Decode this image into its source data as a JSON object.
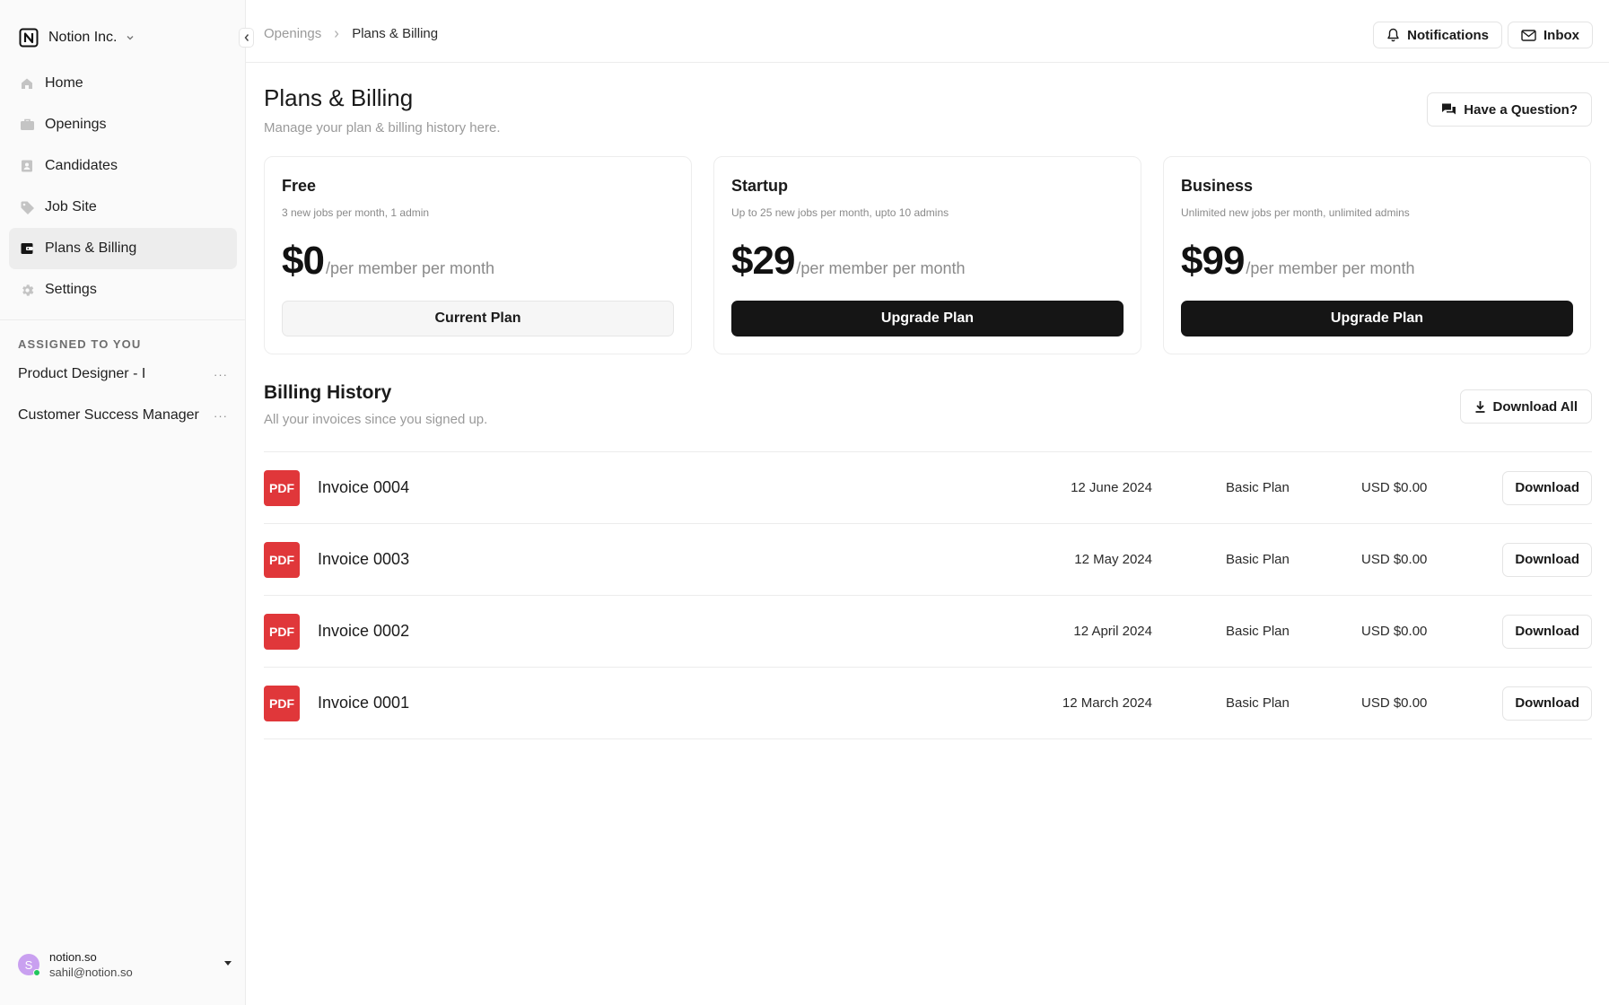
{
  "workspace": {
    "name": "Notion Inc."
  },
  "sidebar": {
    "items": [
      {
        "label": "Home",
        "icon": "home-icon",
        "active": false
      },
      {
        "label": "Openings",
        "icon": "briefcase-icon",
        "active": false
      },
      {
        "label": "Candidates",
        "icon": "contact-card-icon",
        "active": false
      },
      {
        "label": "Job Site",
        "icon": "tag-icon",
        "active": false
      },
      {
        "label": "Plans & Billing",
        "icon": "wallet-icon",
        "active": true
      },
      {
        "label": "Settings",
        "icon": "gear-icon",
        "active": false
      }
    ],
    "assigned_title": "ASSIGNED TO YOU",
    "assigned": [
      {
        "label": "Product Designer - I",
        "more": "···"
      },
      {
        "label": "Customer Success Manager",
        "more": "···"
      }
    ]
  },
  "user": {
    "initial": "S",
    "name": "notion.so",
    "email": "sahil@notion.so"
  },
  "header": {
    "breadcrumb": {
      "parent": "Openings",
      "current": "Plans & Billing"
    },
    "notifications_label": "Notifications",
    "inbox_label": "Inbox"
  },
  "page": {
    "title": "Plans & Billing",
    "subtitle": "Manage your plan & billing history here.",
    "question_label": "Have a Question?"
  },
  "plans": [
    {
      "name": "Free",
      "desc": "3 new jobs per month, 1 admin",
      "price": "$0",
      "per": "/per member per month",
      "button": "Current Plan",
      "current": true
    },
    {
      "name": "Startup",
      "desc": "Up to 25 new jobs per month, upto 10 admins",
      "price": "$29",
      "per": "/per member per month",
      "button": "Upgrade Plan",
      "current": false
    },
    {
      "name": "Business",
      "desc": "Unlimited new jobs per month, unlimited admins",
      "price": "$99",
      "per": "/per member per month",
      "button": "Upgrade Plan",
      "current": false
    }
  ],
  "billing": {
    "title": "Billing History",
    "subtitle": "All your invoices since you signed up.",
    "download_all_label": "Download All",
    "invoices": [
      {
        "badge": "PDF",
        "name": "Invoice 0004",
        "date": "12 June 2024",
        "plan": "Basic Plan",
        "amount": "USD $0.00",
        "action": "Download"
      },
      {
        "badge": "PDF",
        "name": "Invoice 0003",
        "date": "12 May 2024",
        "plan": "Basic Plan",
        "amount": "USD $0.00",
        "action": "Download"
      },
      {
        "badge": "PDF",
        "name": "Invoice 0002",
        "date": "12 April 2024",
        "plan": "Basic Plan",
        "amount": "USD $0.00",
        "action": "Download"
      },
      {
        "badge": "PDF",
        "name": "Invoice 0001",
        "date": "12 March 2024",
        "plan": "Basic Plan",
        "amount": "USD $0.00",
        "action": "Download"
      }
    ]
  },
  "colors": {
    "accent_dark": "#151515",
    "pdf_red": "#e0373a",
    "online": "#22c55e",
    "avatar": "#c9a0f0"
  }
}
